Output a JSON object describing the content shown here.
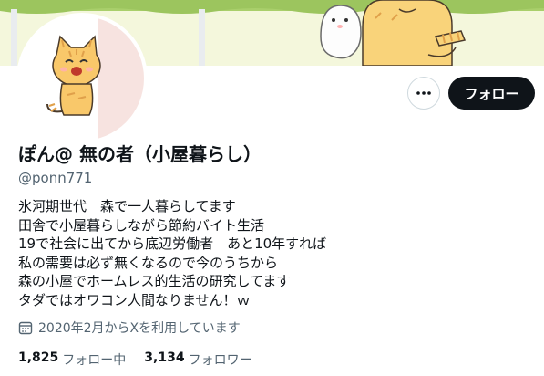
{
  "profile": {
    "display_name": "ぽん@ 無の者（小屋暮らし）",
    "handle": "@ponn771",
    "bio_lines": [
      "氷河期世代　森で一人暮らしてます",
      "田舎で小屋暮らしながら節約バイト生活",
      "19で社会に出てから底辺労働者　あと10年すれば",
      "私の需要は必ず無くなるので今のうちから",
      "森の小屋でホームレス的生活の研究してます",
      "タダではオワコン人間なりません！ｗ"
    ],
    "joined": "2020年2月からXを利用しています"
  },
  "actions": {
    "more_icon": "more-icon",
    "follow_label": "フォロー"
  },
  "stats": {
    "following_count": "1,825",
    "following_label": "フォロー中",
    "followers_count": "3,134",
    "followers_label": "フォロワー"
  },
  "icons": {
    "calendar": "calendar-icon"
  },
  "colors": {
    "follow_button_bg": "#0f1419",
    "secondary_text": "#536471",
    "banner_grass": "#a9cf6b"
  }
}
